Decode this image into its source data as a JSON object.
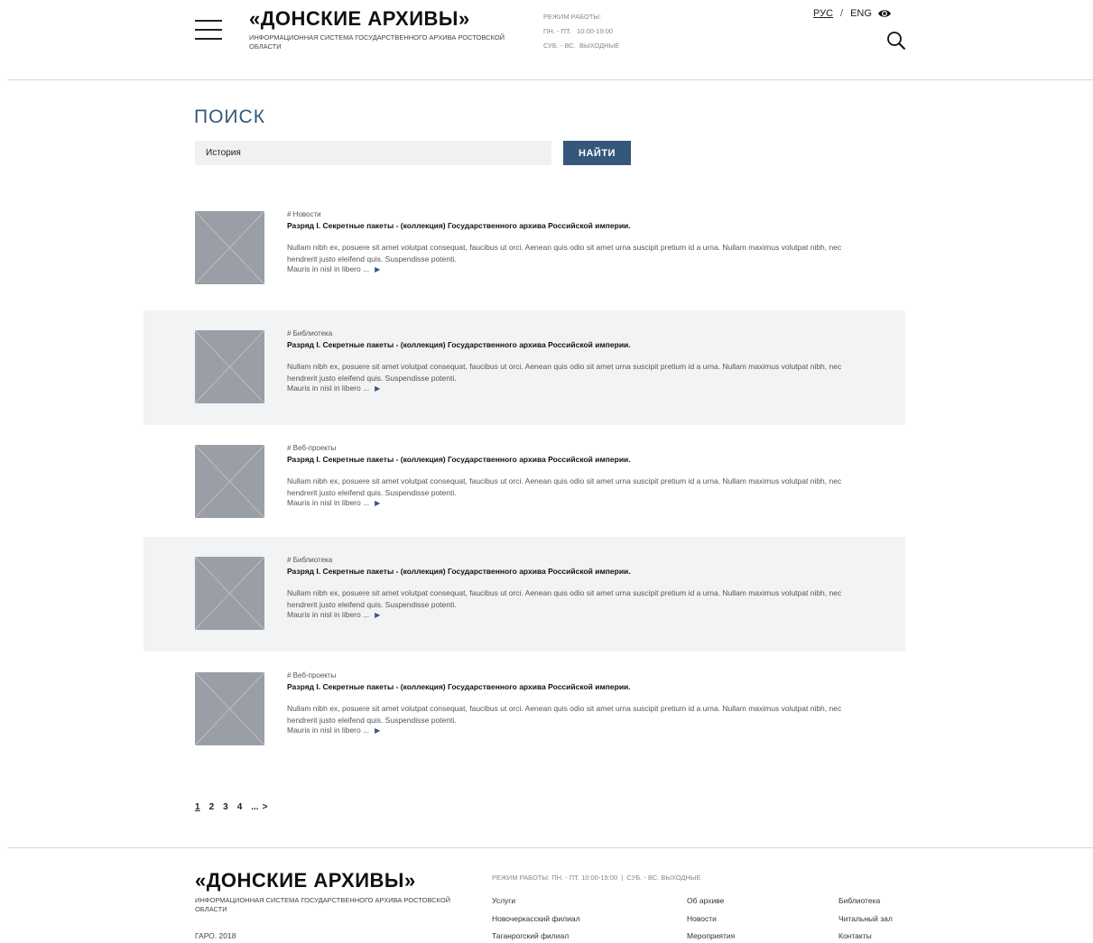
{
  "header": {
    "logo_title": "«ДОНСКИЕ АРХИВЫ»",
    "logo_subtitle": "ИНФОРМАЦИОННАЯ СИСТЕМА ГОСУДАРСТВЕННОГО АРХИВА РОСТОВСКОЙ ОБЛАСТИ",
    "hours_label": "РЕЖИМ РАБОТЫ:",
    "hours_weekdays": "ПН. - ПТ.   10:00-19:00",
    "hours_weekend": "СУБ. - ВС.  ВЫХОДНЫЕ",
    "lang_rus": "РУС",
    "lang_sep": "/",
    "lang_eng": "ENG",
    "icons": [
      "menu-icon",
      "eye-icon",
      "search-icon"
    ]
  },
  "search": {
    "title": "ПОИСК",
    "query": "История",
    "button_label": "НАЙТИ"
  },
  "results": [
    {
      "tag": "# Новости",
      "title": "Разряд I. Секретные пакеты - (коллекция) Государственного архива Российской империи.",
      "text": "Nullam nibh ex, posuere sit amet volutpat consequat, faucibus ut orci. Aenean quis odio sit amet urna suscipit pretium id a urna. Nullam maximus volutpat nibh, nec hendrerit justo eleifend quis. Suspendisse potenti.",
      "more": "Mauris in nisl in libero ..."
    },
    {
      "tag": "# Библиотека",
      "title": "Разряд I. Секретные пакеты - (коллекция) Государственного архива Российской империи.",
      "text": "Nullam nibh ex, posuere sit amet volutpat consequat, faucibus ut orci. Aenean quis odio sit amet urna suscipit pretium id a urna. Nullam maximus volutpat nibh, nec hendrerit justo eleifend quis. Suspendisse potenti.",
      "more": "Mauris in nisl in libero ..."
    },
    {
      "tag": "# Веб-проекты",
      "title": "Разряд I. Секретные пакеты - (коллекция) Государственного архива Российской империи.",
      "text": "Nullam nibh ex, posuere sit amet volutpat consequat, faucibus ut orci. Aenean quis odio sit amet urna suscipit pretium id a urna. Nullam maximus volutpat nibh, nec hendrerit justo eleifend quis. Suspendisse potenti.",
      "more": "Mauris in nisl in libero ..."
    },
    {
      "tag": "# Библиотека",
      "title": "Разряд I. Секретные пакеты - (коллекция) Государственного архива Российской империи.",
      "text": "Nullam nibh ex, posuere sit amet volutpat consequat, faucibus ut orci. Aenean quis odio sit amet urna suscipit pretium id a urna. Nullam maximus volutpat nibh, nec hendrerit justo eleifend quis. Suspendisse potenti.",
      "more": "Mauris in nisl in libero ..."
    },
    {
      "tag": "# Веб-проекты",
      "title": "Разряд I. Секретные пакеты - (коллекция) Государственного архива Российской империи.",
      "text": "Nullam nibh ex, posuere sit amet volutpat consequat, faucibus ut orci. Aenean quis odio sit amet urna suscipit pretium id a urna. Nullam maximus volutpat nibh, nec hendrerit justo eleifend quis. Suspendisse potenti.",
      "more": "Mauris in nisl in libero ..."
    }
  ],
  "pagination": {
    "pages": [
      "1",
      "2",
      "3",
      "4",
      "..."
    ],
    "current": "1",
    "next": ">"
  },
  "footer": {
    "logo_title": "«ДОНСКИЕ АРХИВЫ»",
    "logo_subtitle": "ИНФОРМАЦИОННАЯ СИСТЕМА ГОСУДАРСТВЕННОГО АРХИВА РОСТОВСКОЙ ОБЛАСТИ",
    "copyright": "ГАРО. 2018",
    "hours": "РЕЖИМ РАБОТЫ: ПН. - ПТ. 10:00-19:00  |  СУБ. - ВС. ВЫХОДНЫЕ",
    "col1": [
      "Услуги",
      "Новочеркасский филиал",
      "Таганрогский филиал"
    ],
    "col2": [
      "Об архиве",
      "Новости",
      "Мероприятия"
    ],
    "col3": [
      "Библиотека",
      "Читальный зал",
      "Контакты"
    ]
  },
  "colors": {
    "accent": "#35577a",
    "thumb": "#9a9ea6",
    "shaded_row": "#f2f3f5"
  }
}
